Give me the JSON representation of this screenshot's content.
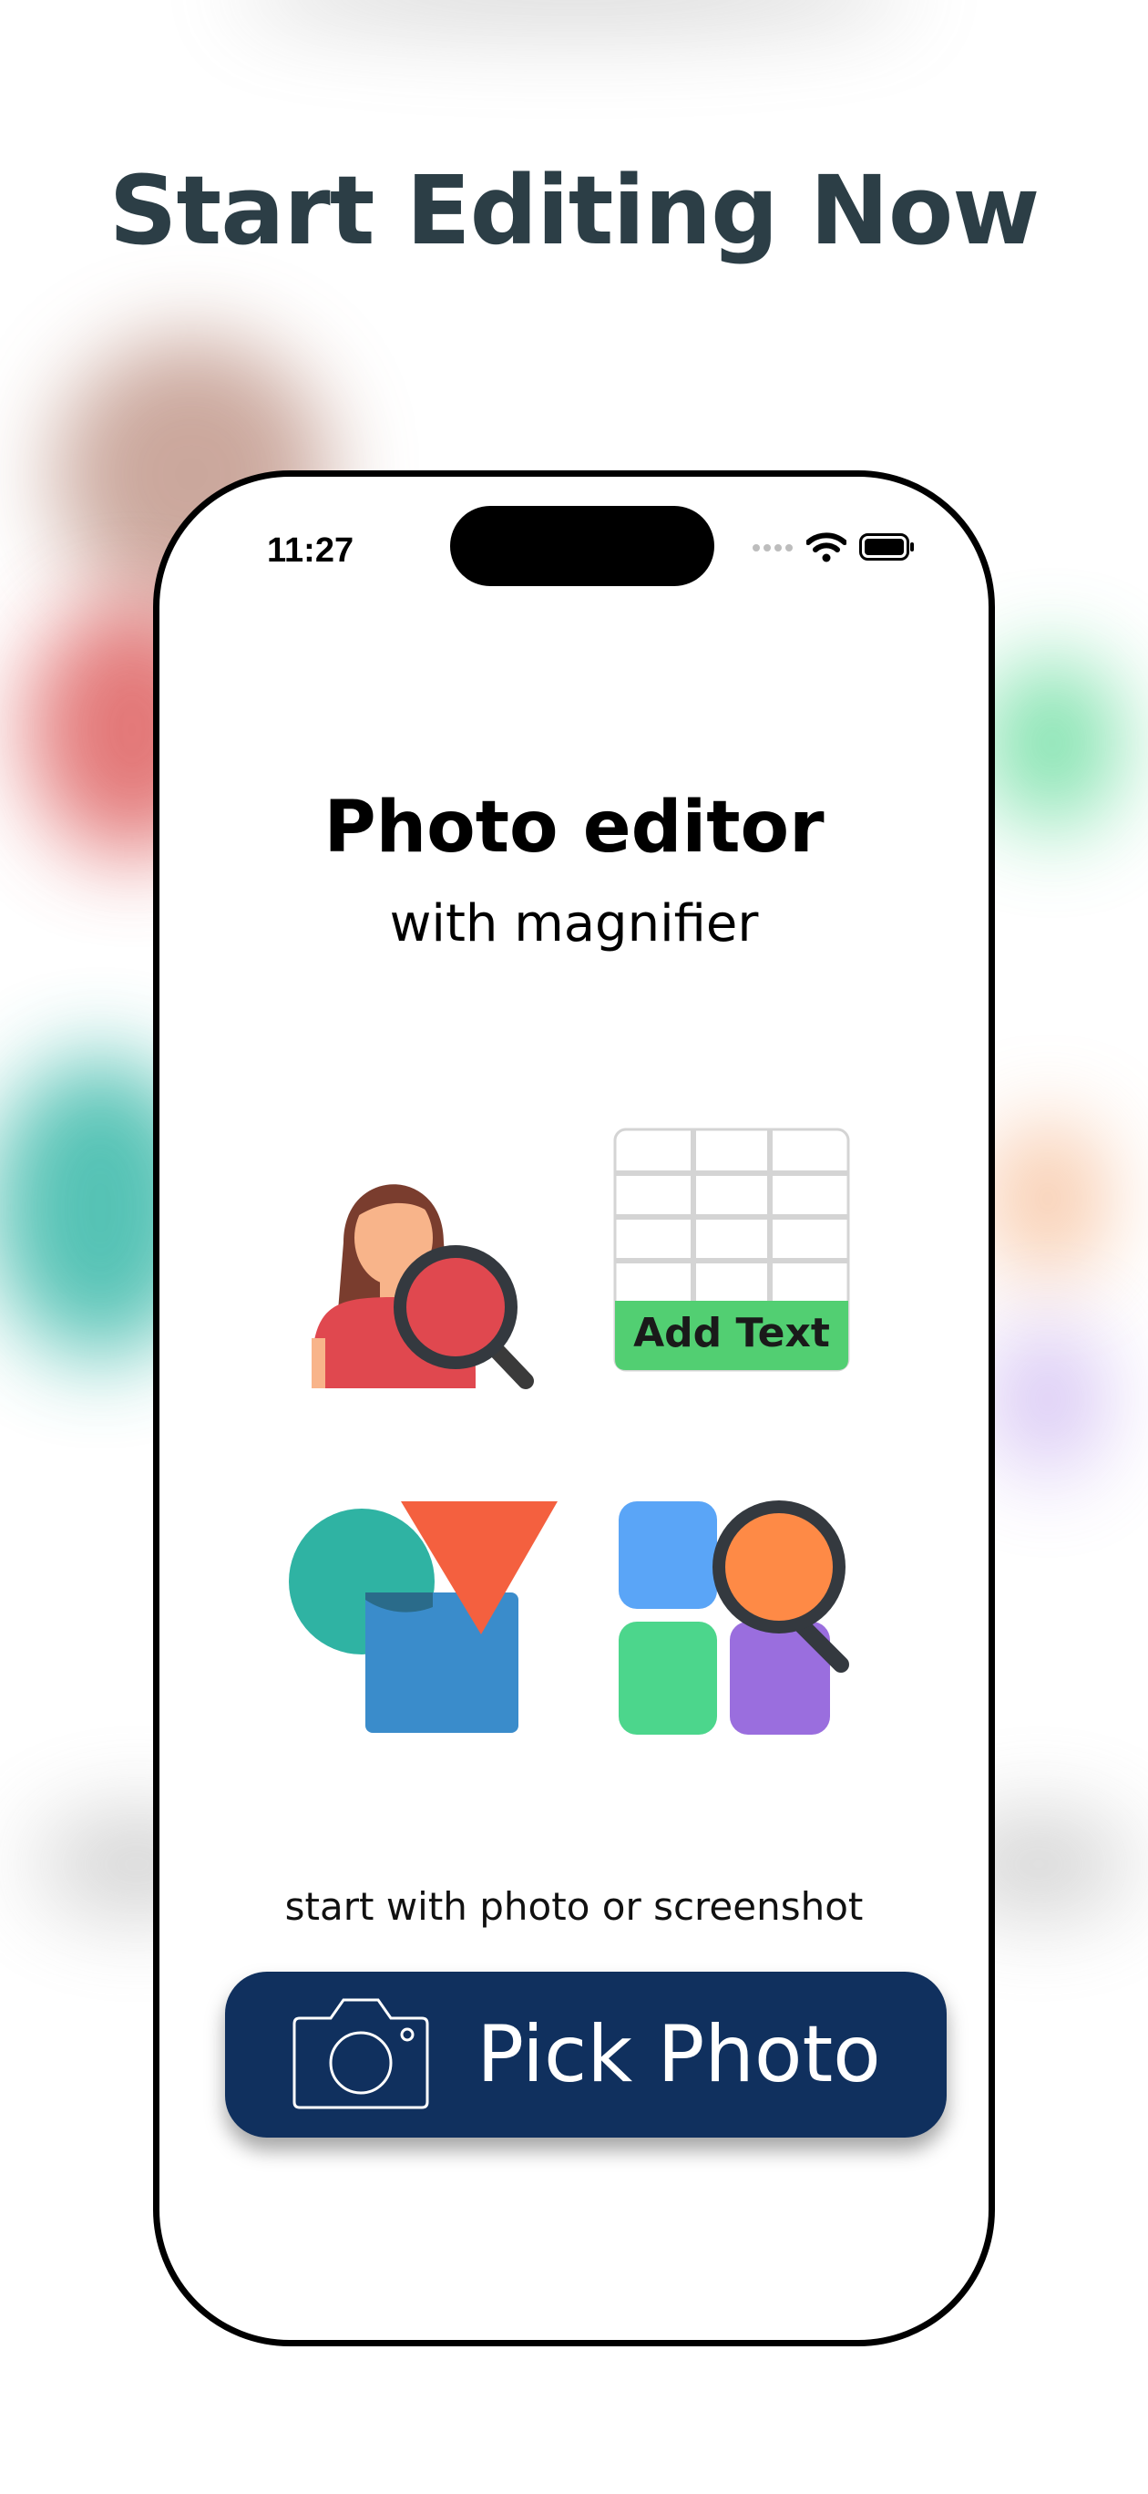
{
  "headline": "Start Editing Now",
  "status_bar": {
    "time": "11:27",
    "icons": [
      "signal-dots-icon",
      "wifi-icon",
      "battery-icon"
    ]
  },
  "app": {
    "title": "Photo editor",
    "subtitle": "with magnifier",
    "features": [
      {
        "icon": "person-magnifier-icon"
      },
      {
        "icon": "add-text-grid-icon",
        "label": "Add Text"
      },
      {
        "icon": "shapes-icon"
      },
      {
        "icon": "app-grid-magnifier-icon"
      }
    ],
    "caption": "start with photo or screenshot",
    "pick_button": {
      "label": "Pick Photo",
      "icon": "camera-icon"
    }
  },
  "colors": {
    "headline": "#2c3e46",
    "button": "#10305e",
    "red": "#e0484f",
    "teal": "#2fb3a3",
    "orange": "#f4603f",
    "blue": "#3a8ccb",
    "green": "#4cd68c",
    "purple": "#9a6ede",
    "light_blue": "#5aa5f7",
    "magnifier_orange": "#fe8a46"
  }
}
